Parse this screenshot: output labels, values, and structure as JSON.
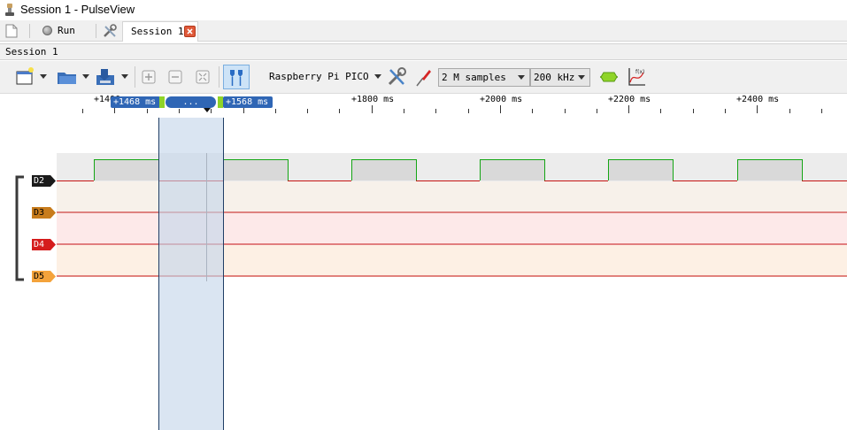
{
  "window": {
    "title": "Session 1 - PulseView"
  },
  "tabbar": {
    "run_label": "Run",
    "session_tab_label": "Session 1"
  },
  "session_header": {
    "label": "Session 1"
  },
  "toolbar": {
    "device": "Raspberry Pi PICO",
    "samples": "2 M samples",
    "rate": "200 kHz"
  },
  "ruler": {
    "labels": [
      "+1400",
      "+1800 ms",
      "+2000 ms",
      "+2200 ms",
      "+2400 ms"
    ]
  },
  "cursors": {
    "left": "+1468 ms",
    "middle": "...",
    "right": "+1568 ms"
  },
  "channels": [
    {
      "name": "D2",
      "color": "#1a1a1a"
    },
    {
      "name": "D3",
      "color": "#c87c1c"
    },
    {
      "name": "D4",
      "color": "#d51c1c"
    },
    {
      "name": "D5",
      "color": "#f4a33b"
    }
  ],
  "colors": {
    "high_trace": "#14a514",
    "low_trace": "#c51414",
    "cursor_fill": "#c3d5ea",
    "cursor_flag": "#2f66b5"
  }
}
